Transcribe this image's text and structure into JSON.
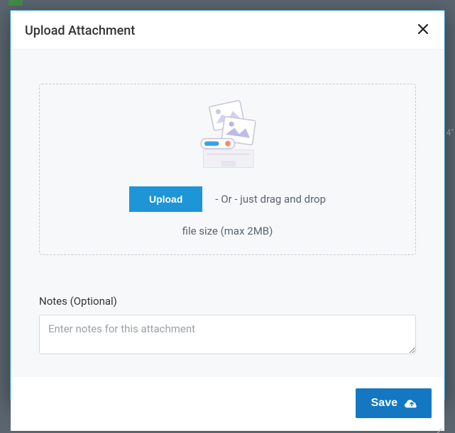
{
  "modal": {
    "title": "Upload Attachment"
  },
  "dropzone": {
    "upload_button": "Upload",
    "drag_text": "- Or - just drag and drop",
    "size_text": "file size (max 2MB)"
  },
  "notes": {
    "label": "Notes (Optional)",
    "placeholder": "Enter notes for this attachment"
  },
  "footer": {
    "save": "Save"
  }
}
